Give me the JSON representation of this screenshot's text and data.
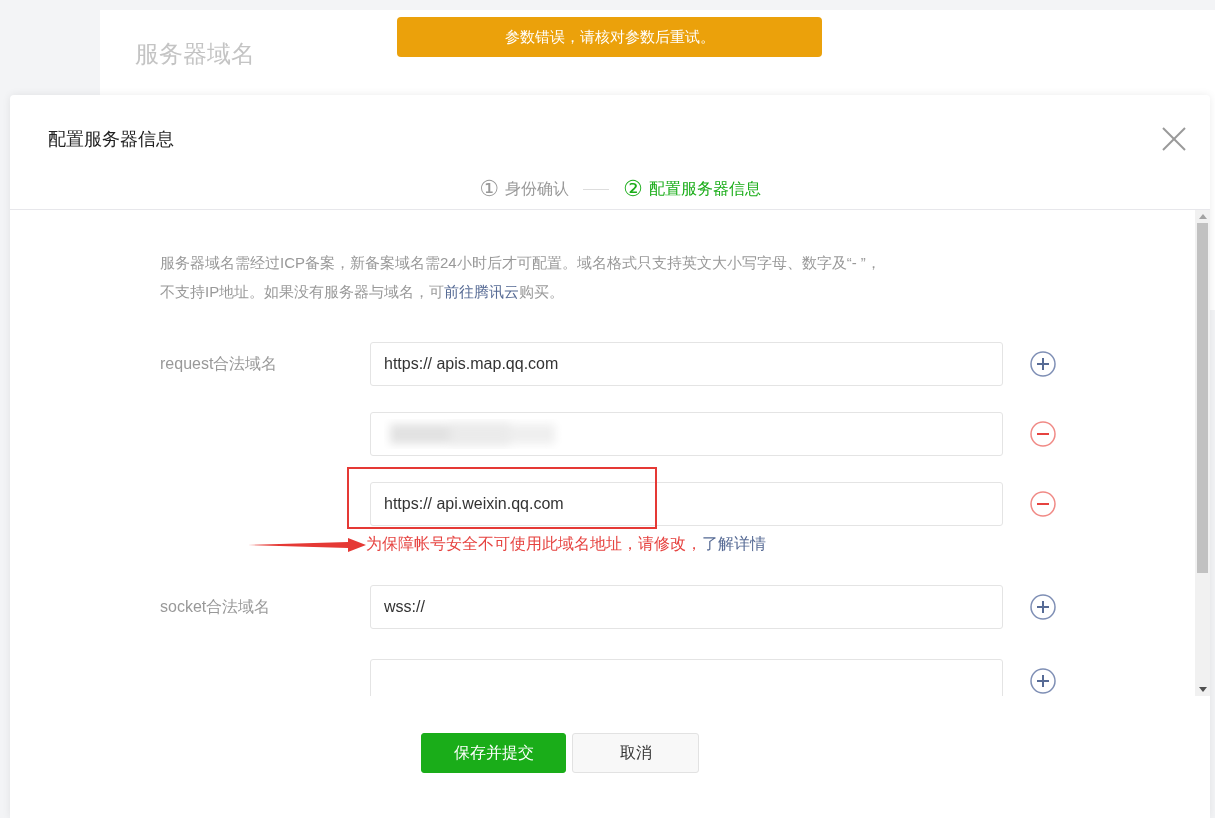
{
  "background_card": {
    "title": "服务器域名"
  },
  "toast": {
    "text": "参数错误，请核对参数后重试。"
  },
  "dialog": {
    "title": "配置服务器信息",
    "steps": [
      {
        "number": "①",
        "label": "身份确认",
        "selected": false
      },
      {
        "number": "②",
        "label": "配置服务器信息",
        "selected": true
      }
    ],
    "intro": {
      "lines": [
        "服务器域名需经过ICP备案，新备案域名需24小时后才可配置。域名格式只支持英文大小写字母、数字及“- ”，",
        "不支持IP地址。如果没有服务器与域名，可"
      ],
      "link": "前往腾讯云",
      "after": "购买。"
    },
    "domains": [
      {
        "label": "request合法域名",
        "entries": [
          {
            "kind": "add",
            "value": "https:// apis.map.qq.com",
            "blurred": false,
            "highlighted": false
          },
          {
            "kind": "remove",
            "blurred": true,
            "highlighted": false
          },
          {
            "kind": "remove",
            "value": "https:// api.weixin.qq.com",
            "blurred": false,
            "highlighted": true,
            "error": {
              "text": "为保障帐号安全不可使用此域名地址，请修改，",
              "link": "了解详情"
            }
          }
        ]
      },
      {
        "label": "socket合法域名",
        "entries": [
          {
            "kind": "add",
            "value": "wss://",
            "blurred": false,
            "highlighted": false
          }
        ]
      },
      {
        "entries": [
          {
            "kind": "add",
            "blurred": false,
            "highlighted": false
          }
        ]
      }
    ],
    "buttons": [
      {
        "label": "保存并提交",
        "kind": "primary"
      },
      {
        "label": "取消",
        "kind": "default"
      }
    ]
  }
}
